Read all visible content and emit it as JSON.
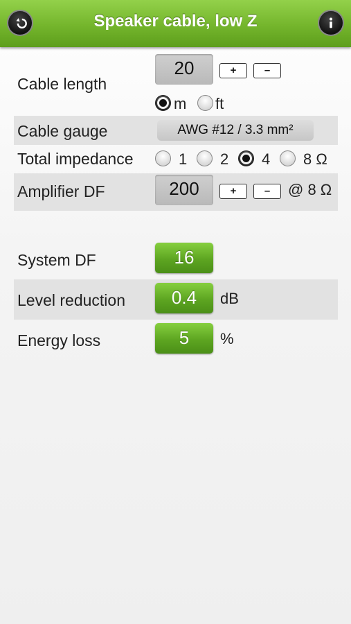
{
  "header": {
    "title": "Speaker cable, low Z",
    "back_icon": "back-arrow-icon",
    "info_icon": "info-icon"
  },
  "cable_length": {
    "label": "Cable length",
    "value": "20",
    "plus": "+",
    "minus": "–",
    "units": [
      {
        "label": "m",
        "selected": true
      },
      {
        "label": "ft",
        "selected": false
      }
    ]
  },
  "cable_gauge": {
    "label": "Cable gauge",
    "value": "AWG #12 / 3.3 mm²"
  },
  "total_impedance": {
    "label": "Total impedance",
    "options": [
      {
        "label": "1",
        "selected": false
      },
      {
        "label": "2",
        "selected": false
      },
      {
        "label": "4",
        "selected": true
      },
      {
        "label": "8 Ω",
        "selected": false
      }
    ]
  },
  "amplifier_df": {
    "label": "Amplifier DF",
    "value": "200",
    "plus": "+",
    "minus": "–",
    "suffix": "@ 8 Ω"
  },
  "results": {
    "system_df": {
      "label": "System DF",
      "value": "16"
    },
    "level_reduction": {
      "label": "Level reduction",
      "value": "0.4",
      "unit": "dB"
    },
    "energy_loss": {
      "label": "Energy loss",
      "value": "5",
      "unit": "%"
    }
  }
}
